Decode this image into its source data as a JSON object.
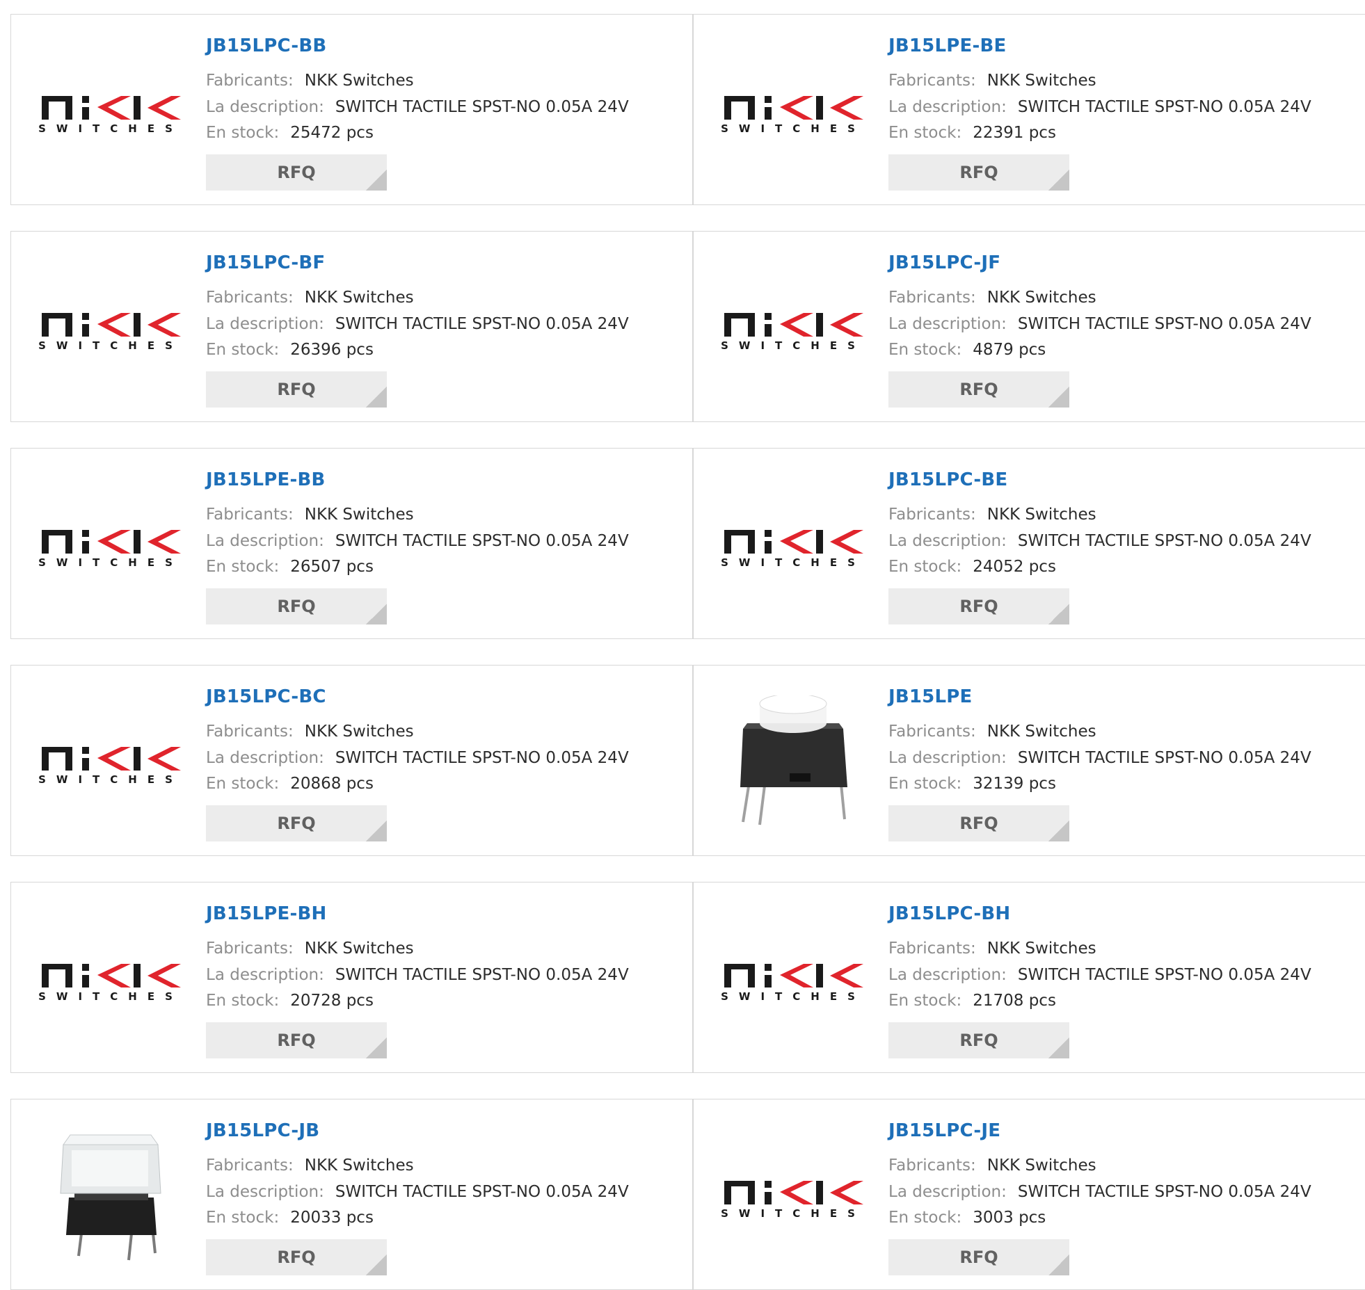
{
  "labels": {
    "manufacturer": "Fabricants:",
    "description": "La description:",
    "stock": "En stock:",
    "rfq": "RFQ"
  },
  "logo": {
    "brand": "NKK",
    "tagline": "SWITCHES"
  },
  "products": [
    {
      "part": "JB15LPC-BB",
      "manufacturer": "NKK Switches",
      "description": "SWITCH TACTILE SPST-NO 0.05A 24V",
      "stock": "25472 pcs",
      "image": "nkk-logo"
    },
    {
      "part": "JB15LPE-BE",
      "manufacturer": "NKK Switches",
      "description": "SWITCH TACTILE SPST-NO 0.05A 24V",
      "stock": "22391 pcs",
      "image": "nkk-logo"
    },
    {
      "part": "JB15LPC-BF",
      "manufacturer": "NKK Switches",
      "description": "SWITCH TACTILE SPST-NO 0.05A 24V",
      "stock": "26396 pcs",
      "image": "nkk-logo"
    },
    {
      "part": "JB15LPC-JF",
      "manufacturer": "NKK Switches",
      "description": "SWITCH TACTILE SPST-NO 0.05A 24V",
      "stock": "4879 pcs",
      "image": "nkk-logo"
    },
    {
      "part": "JB15LPE-BB",
      "manufacturer": "NKK Switches",
      "description": "SWITCH TACTILE SPST-NO 0.05A 24V",
      "stock": "26507 pcs",
      "image": "nkk-logo"
    },
    {
      "part": "JB15LPC-BE",
      "manufacturer": "NKK Switches",
      "description": "SWITCH TACTILE SPST-NO 0.05A 24V",
      "stock": "24052 pcs",
      "image": "nkk-logo"
    },
    {
      "part": "JB15LPC-BC",
      "manufacturer": "NKK Switches",
      "description": "SWITCH TACTILE SPST-NO 0.05A 24V",
      "stock": "20868 pcs",
      "image": "nkk-logo"
    },
    {
      "part": "JB15LPE",
      "manufacturer": "NKK Switches",
      "description": "SWITCH TACTILE SPST-NO 0.05A 24V",
      "stock": "32139 pcs",
      "image": "switch-photo-round"
    },
    {
      "part": "JB15LPE-BH",
      "manufacturer": "NKK Switches",
      "description": "SWITCH TACTILE SPST-NO 0.05A 24V",
      "stock": "20728 pcs",
      "image": "nkk-logo"
    },
    {
      "part": "JB15LPC-BH",
      "manufacturer": "NKK Switches",
      "description": "SWITCH TACTILE SPST-NO 0.05A 24V",
      "stock": "21708 pcs",
      "image": "nkk-logo"
    },
    {
      "part": "JB15LPC-JB",
      "manufacturer": "NKK Switches",
      "description": "SWITCH TACTILE SPST-NO 0.05A 24V",
      "stock": "20033 pcs",
      "image": "switch-photo-square"
    },
    {
      "part": "JB15LPC-JE",
      "manufacturer": "NKK Switches",
      "description": "SWITCH TACTILE SPST-NO 0.05A 24V",
      "stock": "3003 pcs",
      "image": "nkk-logo"
    }
  ],
  "colors": {
    "part_link": "#1e6fb8",
    "label": "#8d8d8d",
    "value": "#2c2c2c",
    "border": "#d7d7d7",
    "rfq_bg": "#ececec",
    "logo_dark": "#1a1a1a",
    "logo_red": "#e0242c"
  }
}
